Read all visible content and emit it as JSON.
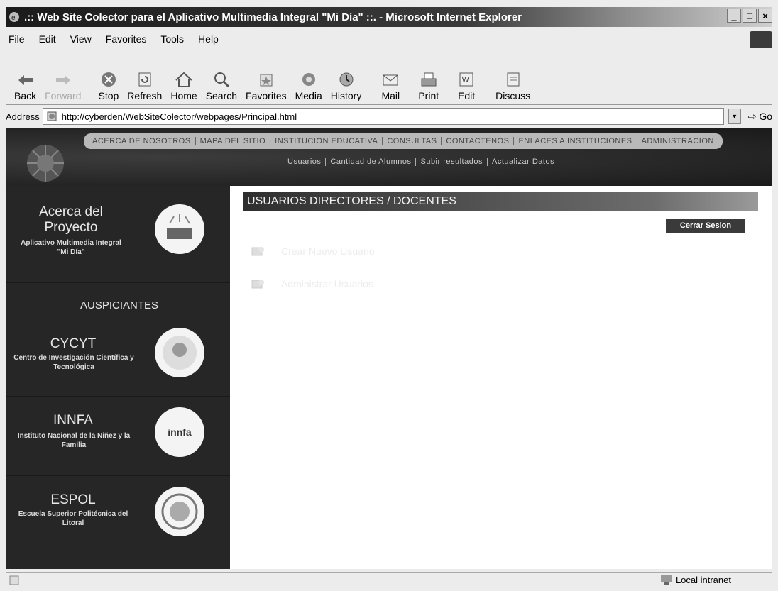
{
  "window": {
    "title": ".:: Web Site Colector para el Aplicativo Multimedia Integral \"Mi Día\" ::. - Microsoft Internet Explorer",
    "buttons": [
      "_",
      "□",
      "×"
    ]
  },
  "menu": {
    "items": [
      "File",
      "Edit",
      "View",
      "Favorites",
      "Tools",
      "Help"
    ]
  },
  "toolbar": {
    "back": "Back",
    "forward": "Forward",
    "stop": "Stop",
    "refresh": "Refresh",
    "home": "Home",
    "search": "Search",
    "favorites": "Favorites",
    "media": "Media",
    "history": "History",
    "mail": "Mail",
    "print": "Print",
    "edit": "Edit",
    "discuss": "Discuss"
  },
  "address": {
    "label": "Address",
    "url": "http://cyberden/WebSiteColector/webpages/Principal.html",
    "go": "Go"
  },
  "site": {
    "nav": [
      "ACERCA DE NOSOTROS",
      "MAPA DEL SITIO",
      "INSTITUCION EDUCATIVA",
      "CONSULTAS",
      "CONTACTENOS",
      "ENLACES A INSTITUCIONES",
      "ADMINISTRACION"
    ],
    "subnav": [
      "Usuarios",
      "Cantidad de Alumnos",
      "Subir resultados",
      "Actualizar Datos"
    ],
    "sidebar": {
      "about_title": "Acerca del Proyecto",
      "about_sub": "Aplicativo Multimedia Integral \"Mi Día\"",
      "sponsors": "AUSPICIANTES",
      "cycyt_title": "CYCYT",
      "cycyt_sub": "Centro de Investigación Científica y Tecnológica",
      "innfa_title": "INNFA",
      "innfa_sub": "Instituto Nacional de la Niñez y la Familia",
      "innfa_logo": "innfa",
      "espol_title": "ESPOL",
      "espol_sub": "Escuela Superior Politécnica del Litoral"
    },
    "header": "USUARIOS DIRECTORES / DOCENTES",
    "logout": "Cerrar Sesion",
    "links": [
      "Crear Nuevo Usuario",
      "Administrar Usuarios"
    ]
  },
  "status": {
    "zone": "Local intranet"
  }
}
